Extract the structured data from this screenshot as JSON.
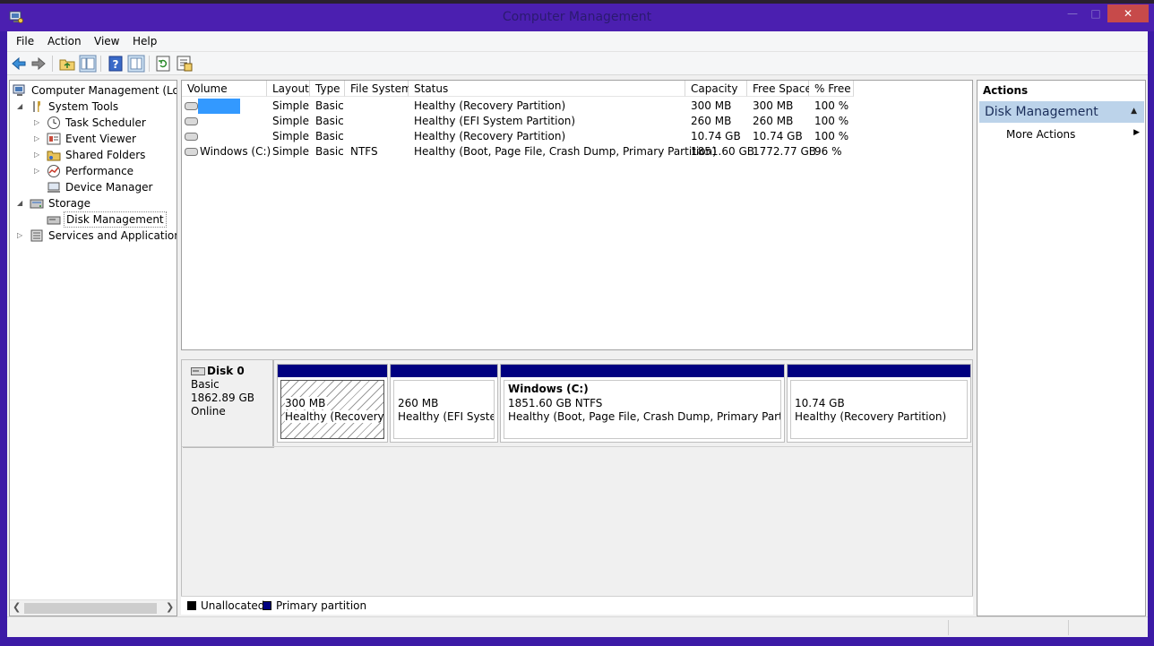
{
  "window": {
    "title": "Computer Management"
  },
  "menu": [
    "File",
    "Action",
    "View",
    "Help"
  ],
  "toolbar_icons": [
    "back-arrow-icon",
    "forward-arrow-icon",
    "up-folder-icon",
    "show-hide-tree-icon",
    "help-icon",
    "properties-icon",
    "refresh-icon",
    "export-list-icon"
  ],
  "tree": {
    "root": "Computer Management (Local",
    "system_tools": "System Tools",
    "task_scheduler": "Task Scheduler",
    "event_viewer": "Event Viewer",
    "shared_folders": "Shared Folders",
    "performance": "Performance",
    "device_manager": "Device Manager",
    "storage": "Storage",
    "disk_management": "Disk Management",
    "services": "Services and Applications"
  },
  "volumes": {
    "columns": [
      "Volume",
      "Layout",
      "Type",
      "File System",
      "Status",
      "Capacity",
      "Free Space",
      "% Free"
    ],
    "rows": [
      {
        "volume": "",
        "layout": "Simple",
        "type": "Basic",
        "fs": "",
        "status": "Healthy (Recovery Partition)",
        "capacity": "300 MB",
        "free": "300 MB",
        "pct": "100 %"
      },
      {
        "volume": "",
        "layout": "Simple",
        "type": "Basic",
        "fs": "",
        "status": "Healthy (EFI System Partition)",
        "capacity": "260 MB",
        "free": "260 MB",
        "pct": "100 %"
      },
      {
        "volume": "",
        "layout": "Simple",
        "type": "Basic",
        "fs": "",
        "status": "Healthy (Recovery Partition)",
        "capacity": "10.74 GB",
        "free": "10.74 GB",
        "pct": "100 %"
      },
      {
        "volume": "Windows (C:)",
        "layout": "Simple",
        "type": "Basic",
        "fs": "NTFS",
        "status": "Healthy (Boot, Page File, Crash Dump, Primary Partition)",
        "capacity": "1851.60 GB",
        "free": "1772.77 GB",
        "pct": "96 %"
      }
    ]
  },
  "disk": {
    "name": "Disk 0",
    "type": "Basic",
    "size": "1862.89 GB",
    "state": "Online",
    "partitions": [
      {
        "title": "",
        "size": "300 MB",
        "status": "Healthy (Recovery Pa"
      },
      {
        "title": "",
        "size": "260 MB",
        "status": "Healthy (EFI System"
      },
      {
        "title": "Windows  (C:)",
        "size": "1851.60 GB NTFS",
        "status": "Healthy (Boot, Page File, Crash Dump, Primary Partition)"
      },
      {
        "title": "",
        "size": "10.74 GB",
        "status": "Healthy (Recovery Partition)"
      }
    ]
  },
  "legend": {
    "unallocated": "Unallocated",
    "primary": "Primary partition",
    "unallocated_color": "#000000",
    "primary_color": "#000080"
  },
  "actions": {
    "title": "Actions",
    "section": "Disk Management",
    "more": "More Actions"
  },
  "colors": {
    "title_bar": "#4b1fb0",
    "selection": "#3399ff",
    "close_button": "#c74a4a"
  }
}
